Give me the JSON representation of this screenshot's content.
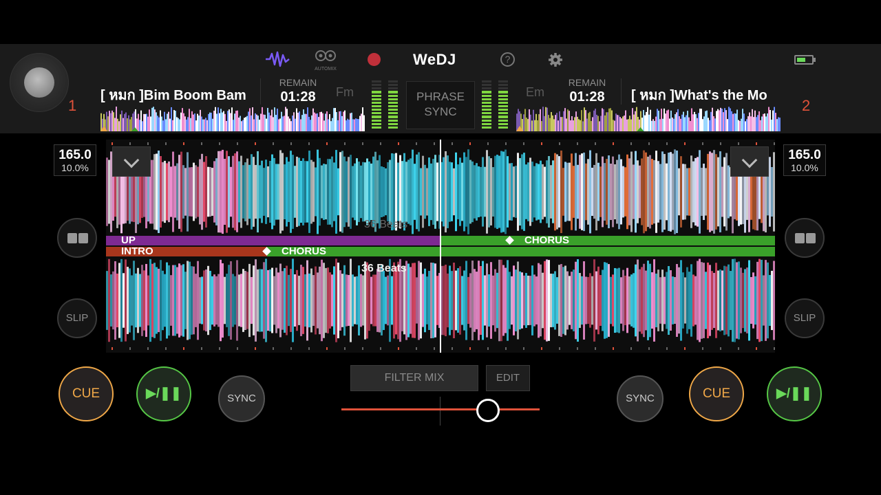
{
  "app": {
    "logo": "WeDJ"
  },
  "header": {
    "icons": [
      "waveform-icon",
      "automix-icon",
      "record-icon",
      "help-icon",
      "settings-icon",
      "battery-icon"
    ],
    "automix_label": "AUTOMIX",
    "help_glyph": "?",
    "phrase_sync_line1": "PHRASE",
    "phrase_sync_line2": "SYNC"
  },
  "deck1": {
    "number": "1",
    "title": "[ หมก ]Bim Boom Bam",
    "remain_label": "REMAIN",
    "remain_time": "01:28",
    "key": "Fm",
    "bpm": "165.0",
    "pitch": "10.0%",
    "play_position": 0.13
  },
  "deck2": {
    "number": "2",
    "title": "[ หมก ]What's the Mo",
    "remain_label": "REMAIN",
    "remain_time": "01:28",
    "key": "Em",
    "bpm": "165.0",
    "pitch": "10.0%",
    "play_position": 0.47
  },
  "waveform": {
    "top_beats": "36 Beats",
    "bottom_beats": "36 Beats",
    "deck1_phrases": [
      {
        "label": "UP",
        "color": "#8a2d9a"
      },
      {
        "label": "CHORUS",
        "color": "#3aa12a"
      }
    ],
    "deck2_phrases": [
      {
        "label": "INTRO",
        "color": "#b33a1e"
      },
      {
        "label": "CHORUS",
        "color": "#3aa12a"
      }
    ]
  },
  "side_buttons": {
    "slip_label": "SLIP"
  },
  "transport": {
    "cue_label": "CUE",
    "play_label": "▶/❚❚",
    "sync_label": "SYNC"
  },
  "mixer": {
    "filter_mix_label": "FILTER MIX",
    "edit_label": "EDIT",
    "crossfader_position": 0.74
  },
  "colors": {
    "accent_red": "#e0523a",
    "cue_orange": "#f0a848",
    "play_green": "#56c846",
    "waveform_cyan": "#3fd6f0",
    "waveform_pink": "#f08fd0"
  }
}
